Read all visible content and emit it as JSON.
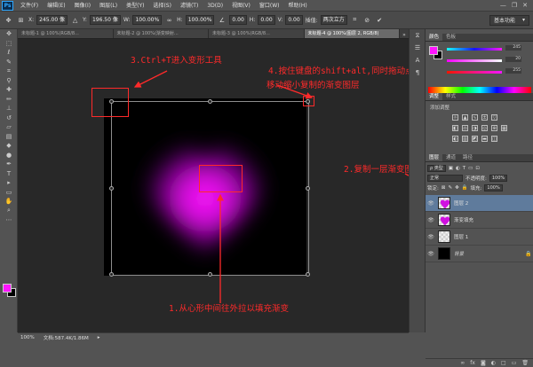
{
  "menubar": {
    "logo": "Ps",
    "items": [
      "文件(F)",
      "编辑(E)",
      "图像(I)",
      "图层(L)",
      "类型(Y)",
      "选择(S)",
      "滤镜(T)",
      "3D(D)",
      "视图(V)",
      "窗口(W)",
      "帮助(H)"
    ],
    "window_controls": [
      "—",
      "❐",
      "✕"
    ]
  },
  "options_bar": {
    "x_label": "X:",
    "x_value": "245.00 像",
    "y_label": "Y:",
    "y_value": "196.50 像",
    "w_label": "W:",
    "w_value": "100.00%",
    "h_label": "H:",
    "h_value": "100.00%",
    "angle_value": "0.00",
    "h_skew_label": "H:",
    "h_skew_value": "0.00",
    "v_skew_label": "V:",
    "v_skew_value": "0.00",
    "interp_label": "插值:",
    "interp_value": "两次立方",
    "workspace": "基本功能"
  },
  "tabs": [
    {
      "label": "未标题-1 @ 100%(RGB/8...",
      "active": false
    },
    {
      "label": "未标题-2 @ 100%(渐变映射...",
      "active": false
    },
    {
      "label": "未标题-3 @ 100%(RGB/8...",
      "active": false
    },
    {
      "label": "未标题-4 @ 100%(图层 2, RGB/8)",
      "active": true
    }
  ],
  "status": {
    "zoom": "100%",
    "doc": "文档:587.4K/1.86M"
  },
  "annotations": {
    "step1": "1.从心形中间往外拉以填充渐变",
    "step2": "2.复制一层渐变图层",
    "step3": "3.Ctrl+T进入变形工具",
    "step4_line1": "4.按住键盘的shift+alt,同时拖动点",
    "step4_line2": "移动缩小复制的渐变图层"
  },
  "color_panel": {
    "tabs": [
      "颜色",
      "色板"
    ],
    "values": [
      "245",
      "20",
      "255"
    ],
    "accent": "#ff14ff"
  },
  "adjust_panel": {
    "tabs": [
      "调整",
      "样式"
    ],
    "subtitle": "添加调整"
  },
  "layers_panel": {
    "tabs": [
      "图层",
      "通道",
      "路径"
    ],
    "kind_label": "ρ 类型",
    "blend_mode": "正常",
    "opacity_label": "不透明度:",
    "opacity_value": "100%",
    "lock_label": "锁定:",
    "fill_label": "填充:",
    "fill_value": "100%",
    "layers": [
      {
        "name": "图层 2",
        "thumb": "heart",
        "selected": true
      },
      {
        "name": "渐变填充",
        "thumb": "heart",
        "selected": false
      },
      {
        "name": "图层 1",
        "thumb": "checker",
        "selected": false
      },
      {
        "name": "背景",
        "thumb": "black",
        "selected": false,
        "locked": true
      }
    ],
    "footer_icons": [
      "fx",
      "◐",
      "□",
      "▭",
      "🗑"
    ]
  },
  "colors": {
    "accent": "#ff14ff",
    "annotation": "#ff2a2a"
  }
}
